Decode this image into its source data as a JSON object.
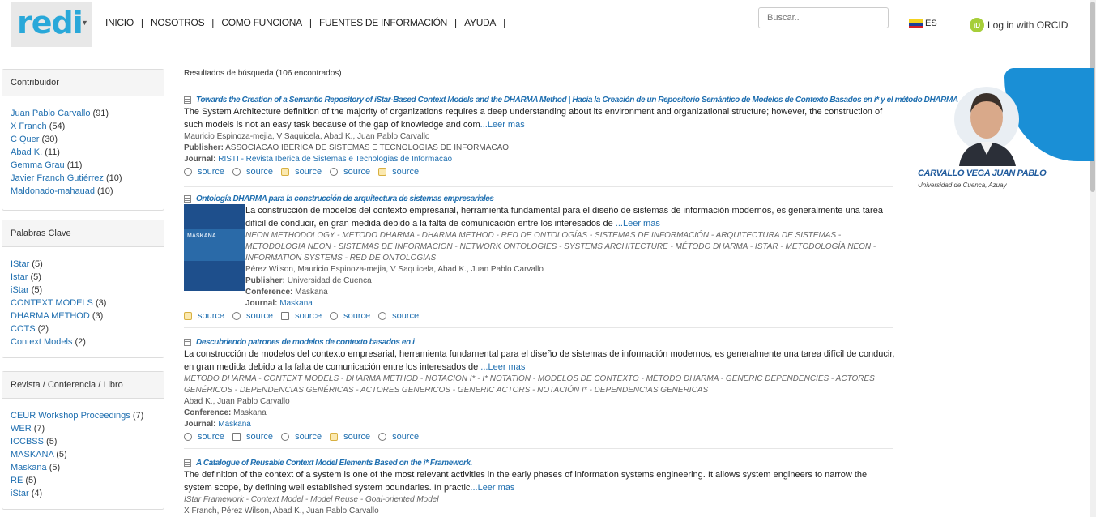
{
  "header": {
    "logo": "redi",
    "nav": [
      "INICIO",
      "NOSOTROS",
      "COMO FUNCIONA",
      "FUENTES DE INFORMACIÓN",
      "AYUDA"
    ],
    "search_placeholder": "Buscar..",
    "language": "ES",
    "orcid_label": "Log in with ORCID",
    "orcid_badge": "iD"
  },
  "facets": {
    "contributor": {
      "title": "Contribuidor",
      "items": [
        {
          "label": "Juan Pablo Carvallo",
          "count": "(91)"
        },
        {
          "label": "X Franch",
          "count": "(54)"
        },
        {
          "label": "C Quer",
          "count": "(30)"
        },
        {
          "label": "Abad K.",
          "count": "(11)"
        },
        {
          "label": "Gemma Grau",
          "count": "(11)"
        },
        {
          "label": "Javier Franch Gutiérrez",
          "count": "(10)"
        },
        {
          "label": "Maldonado-mahauad",
          "count": "(10)"
        }
      ]
    },
    "keywords": {
      "title": "Palabras Clave",
      "items": [
        {
          "label": "IStar",
          "count": "(5)"
        },
        {
          "label": "Istar",
          "count": "(5)"
        },
        {
          "label": "iStar",
          "count": "(5)"
        },
        {
          "label": "CONTEXT MODELS",
          "count": "(3)"
        },
        {
          "label": "DHARMA METHOD",
          "count": "(3)"
        },
        {
          "label": "COTS",
          "count": "(2)"
        },
        {
          "label": "Context Models",
          "count": "(2)"
        }
      ]
    },
    "venue": {
      "title": "Revista / Conferencia / Libro",
      "items": [
        {
          "label": "CEUR Workshop Proceedings",
          "count": "(7)"
        },
        {
          "label": "WER",
          "count": "(7)"
        },
        {
          "label": "ICCBSS",
          "count": "(5)"
        },
        {
          "label": "MASKANA",
          "count": "(5)"
        },
        {
          "label": "Maskana",
          "count": "(5)"
        },
        {
          "label": "RE",
          "count": "(5)"
        },
        {
          "label": "iStar",
          "count": "(4)"
        }
      ]
    }
  },
  "results": {
    "summary": "Resultados de búsqueda (106 encontrados)",
    "read_more": "...Leer mas",
    "source_label": "source",
    "items": [
      {
        "title": "Towards the Creation of a Semantic Repository of iStar-Based Context Models and the DHARMA Method | Hacia la Creación de un Repositorio Semántico de Modelos de Contexto Basados en i* y el método DHARMA",
        "abstract": "The System Architecture definition of the majority of organizations requires a deep understanding about its environment and organizational structure; however, the construction of such models is not an easy task because of the gap of knowledge and com",
        "authors": "Mauricio Espinoza-mejia,   V Saquicela,   Abad K.,   Juan Pablo Carvallo",
        "publisher_label": "Publisher:",
        "publisher": "ASSOCIACAO IBERICA DE SISTEMAS E TECNOLOGIAS DE INFORMACAO",
        "journal_label": "Journal:",
        "journal": "RISTI - Revista Iberica de Sistemas e Tecnologias de Informacao",
        "sources": [
          "web",
          "web",
          "crossref",
          "web",
          "crossref"
        ]
      },
      {
        "title": "Ontología DHARMA para la construcción de arquitectura de sistemas empresariales",
        "abstract": "La construcción de modelos del contexto empresarial, herramienta fundamental para el diseño de sistemas de información modernos, es generalmente una tarea difícil de conducir, en gran medida debido a la falta de comunicación entre los interesados de ",
        "keywords": "NEON METHODOLOGY -   METODO DHARMA -   DHARMA METHOD -   RED DE ONTOLOGÍAS -   SISTEMAS DE INFORMACIÓN -   ARQUITECTURA DE SISTEMAS -   METODOLOGIA NEON -   SISTEMAS DE INFORMACION -   NETWORK ONTOLOGIES -   SYSTEMS ARCHITECTURE -   MÉTODO DHARMA -   ISTAR -   METODOLOGÍA NEON -   INFORMATION SYSTEMS -   RED DE ONTOLOGIAS",
        "authors": "Pérez Wilson,   Mauricio Espinoza-mejia,   V Saquicela,   Abad K.,   Juan Pablo Carvallo",
        "publisher_label": "Publisher:",
        "publisher": "Universidad de Cuenca",
        "conference_label": "Conference:",
        "conference": "Maskana",
        "journal_label": "Journal:",
        "journal": "Maskana",
        "cover_title": "MASKANA",
        "sources": [
          "crossref",
          "web",
          "pdf",
          "web",
          "web"
        ]
      },
      {
        "title": "Descubriendo patrones de modelos de contexto basados en i",
        "abstract": "La construcción de modelos del contexto empresarial, herramienta fundamental para el diseño de sistemas de información modernos, es generalmente una tarea difícil de conducir, en gran medida debido a la falta de comunicación entre los interesados de ",
        "keywords": "METODO DHARMA -   CONTEXT MODELS -   DHARMA METHOD -   NOTACION I* -   I* NOTATION -   MODELOS DE CONTEXTO -   MÉTODO DHARMA -   GENERIC DEPENDENCIES -   ACTORES GENÉRICOS -   DEPENDENCIAS GENÉRICAS -   ACTORES GENERICOS -   GENERIC ACTORS -   NOTACIÓN I* -   DEPENDENCIAS GENERICAS",
        "authors": "Abad K.,   Juan Pablo Carvallo",
        "conference_label": "Conference:",
        "conference": "Maskana",
        "journal_label": "Journal:",
        "journal": "Maskana",
        "sources": [
          "web",
          "pdf",
          "web",
          "crossref",
          "web"
        ]
      },
      {
        "title": "A Catalogue of Reusable Context Model Elements Based on the i* Framework.",
        "abstract": "The definition of the context of a system is one of the most relevant activities in the early phases of information systems engineering. It allows system engineers to narrow the system scope, by defining well established system boundaries. In practic",
        "keywords": "IStar Framework -   Context Model -   Model Reuse -   Goal-oriented Model",
        "authors": "X Franch,   Pérez Wilson,   Abad K.,   Juan Pablo Carvallo"
      }
    ]
  },
  "profile": {
    "name": "CARVALLO VEGA JUAN PABLO",
    "institution": "Universidad de Cuenca,",
    "location": "Azuay",
    "accent": "#1a8fd6"
  }
}
